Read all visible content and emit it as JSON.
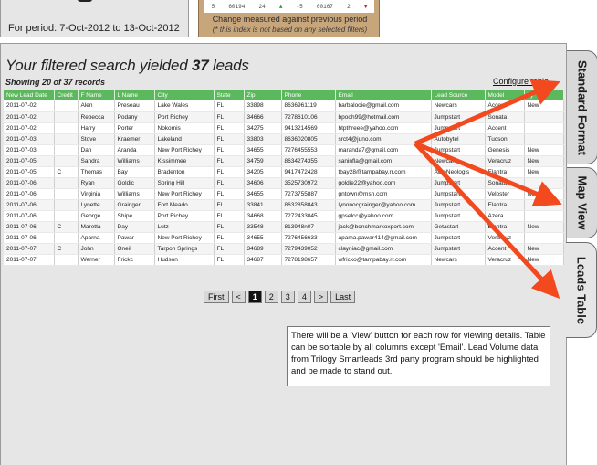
{
  "period": {
    "text": "For period: 7-Oct-2012 to 13-Oct-2012"
  },
  "index_box": {
    "strip": [
      "5",
      "60194",
      "24",
      "-5",
      "60167",
      "2"
    ],
    "line1": "Change measured against previous period",
    "line2": "(* this index is not based on any selected filters)",
    "colors": {
      "box": "#c8a67c",
      "up": "#2b9a3a",
      "down": "#cc2222"
    }
  },
  "heading": {
    "prefix": "Your filtered search yielded ",
    "count": "37",
    "suffix": " leads"
  },
  "showing": "Showing 20 of 37 records",
  "configure_link": "Configure table",
  "table": {
    "header_color": "#5cb85c",
    "columns": [
      "New Lead Date",
      "Credit",
      "F Name",
      "L Name",
      "City",
      "State",
      "Zip",
      "Phone",
      "Email",
      "Lead Source",
      "Model",
      "Ty"
    ],
    "rows": [
      [
        "2011-07-02",
        "",
        "Alen",
        "Preseau",
        "Lake Wales",
        "FL",
        "33898",
        "8636961119",
        "barbalooie@gmail.com",
        "Newcars",
        "Accent",
        "New"
      ],
      [
        "2011-07-02",
        "",
        "Rebecca",
        "Podany",
        "Port Richey",
        "FL",
        "34666",
        "7278610106",
        "bpooh99@hotmail.com",
        "Jumpstart",
        "Sonata",
        ""
      ],
      [
        "2011-07-02",
        "",
        "Harry",
        "Porter",
        "Nokomis",
        "FL",
        "34275",
        "9413214569",
        "htpthreee@yahoo.com",
        "Jumpstart",
        "Accent",
        ""
      ],
      [
        "2011-07-03",
        "",
        "Stove",
        "Kraemer",
        "Lakeland",
        "FL",
        "33803",
        "8636020805",
        "srct4@juno.com",
        "Autobytel",
        "Tucson",
        ""
      ],
      [
        "2011-07-03",
        "",
        "Dan",
        "Aranda",
        "New Port Richey",
        "FL",
        "34655",
        "7276455553",
        "maranda7@gmail.com",
        "Jumpstart",
        "Genesis",
        "New"
      ],
      [
        "2011-07-05",
        "",
        "Sandra",
        "Williams",
        "Kissimmee",
        "FL",
        "34759",
        "8634274355",
        "saninfla@gmail.com",
        "Newcars",
        "Veracruz",
        "New"
      ],
      [
        "2011-07-05",
        "C",
        "Thomas",
        "Bay",
        "Bradenton",
        "FL",
        "34205",
        "9417472428",
        "tbay28@tampabay.rr.com",
        "AutoNeologis",
        "Elantra",
        "New"
      ],
      [
        "2011-07-06",
        "",
        "Ryan",
        "Goldic",
        "Spring Hill",
        "FL",
        "34606",
        "3525730972",
        "goldie22@yahoo.com",
        "Jumpstart",
        "Sonata",
        ""
      ],
      [
        "2011-07-06",
        "",
        "Virginia",
        "Williams",
        "New Port Richey",
        "FL",
        "34655",
        "7273755887",
        "gntown@msn.com",
        "Jumpstart",
        "Veloster",
        "New"
      ],
      [
        "2011-07-06",
        "",
        "Lynette",
        "Grainger",
        "Fort Meado",
        "FL",
        "33841",
        "8632858843",
        "lynonocgrainger@yahoo.com",
        "Jumpstart",
        "Elantra",
        ""
      ],
      [
        "2011-07-06",
        "",
        "George",
        "Shipe",
        "Port Richey",
        "FL",
        "34668",
        "7272433045",
        "gpselcc@yahoo.com",
        "Jumpstart",
        "Azera",
        ""
      ],
      [
        "2011-07-06",
        "C",
        "Maretta",
        "Day",
        "Lutz",
        "FL",
        "33548",
        "813948n07",
        "jack@bonchmarkoxport.com",
        "Getastart",
        "Elantra",
        "New"
      ],
      [
        "2011-07-06",
        "",
        "Aparna",
        "Pawar",
        "New Port Richey",
        "FL",
        "34655",
        "7276456633",
        "apama.pawar414@gmail.com",
        "Jumpstart",
        "Veracruz",
        ""
      ],
      [
        "2011-07-07",
        "C",
        "John",
        "Oneil",
        "Tarpon Springs",
        "FL",
        "34689",
        "7279439052",
        "clayniac@gmail.com",
        "Jumpstart",
        "Accent",
        "New"
      ],
      [
        "2011-07-07",
        "",
        "Werner",
        "Frickc",
        "Hudson",
        "FL",
        "34687",
        "7278198657",
        "wfricko@tampabay.rr.com",
        "Newcars",
        "Veracruz",
        "New"
      ]
    ]
  },
  "pager": {
    "first": "First",
    "prev": "<",
    "pages": [
      "1",
      "2",
      "3",
      "4"
    ],
    "next": ">",
    "last": "Last"
  },
  "note": "There will be a 'View' button for each row for viewing details. Table can be sortable by all columns except 'Email'. Lead Volume data from Trilogy Smartleads 3rd party program should be highlighted and be made to stand out.",
  "tabs": [
    "Standard Format",
    "Map View",
    "Leads Table"
  ],
  "arrow_color": "#f24a1e"
}
